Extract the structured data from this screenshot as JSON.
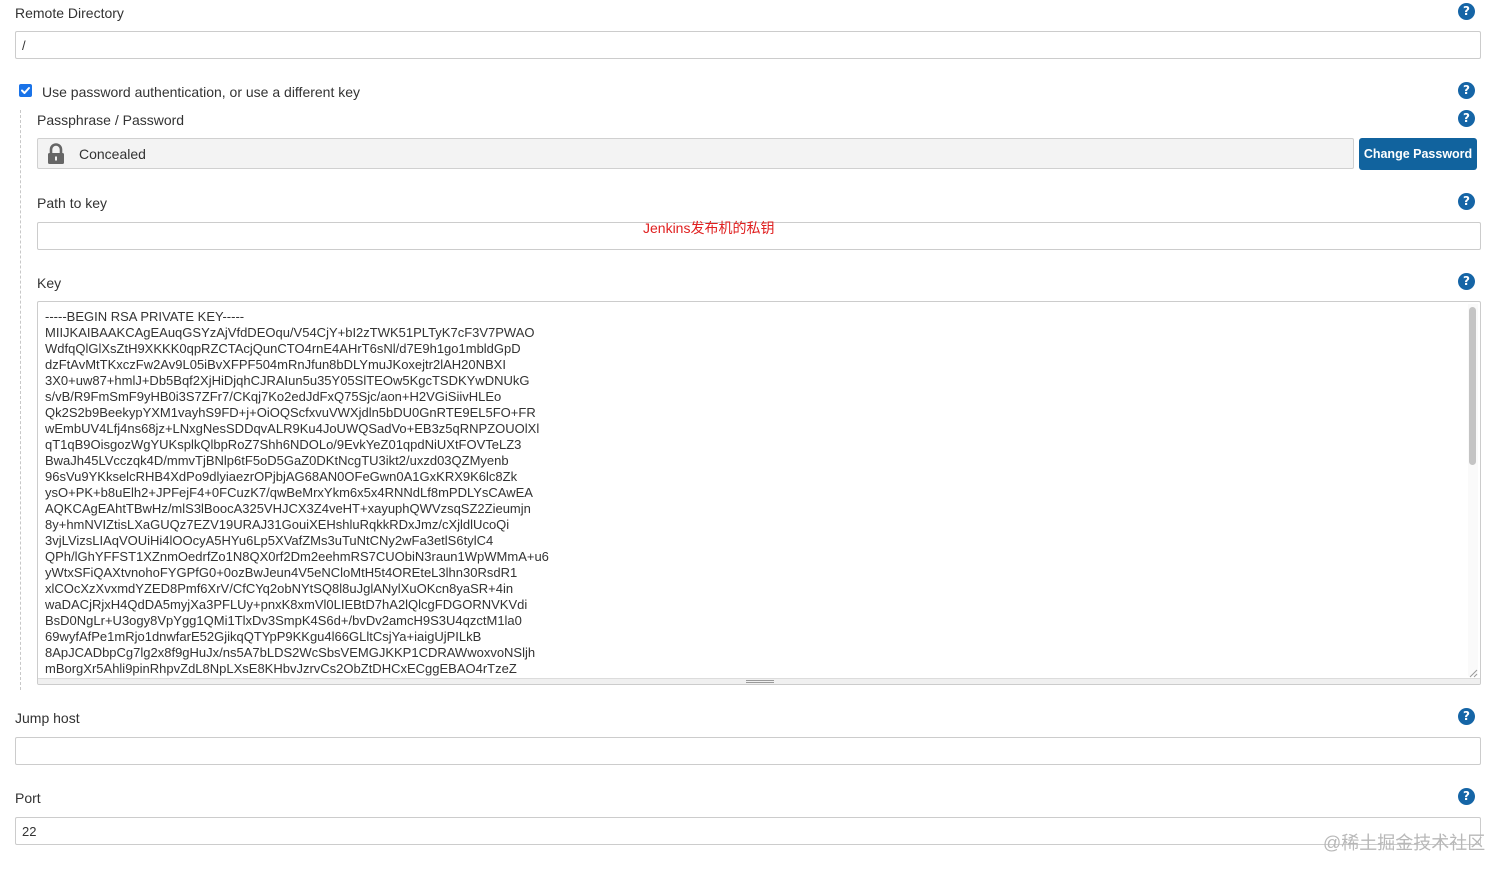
{
  "remote_directory": {
    "label": "Remote Directory",
    "value": "/"
  },
  "password_auth": {
    "checked": true,
    "label": "Use password authentication, or use a different key"
  },
  "passphrase": {
    "label": "Passphrase / Password",
    "concealed_text": "Concealed",
    "change_button": "Change Password"
  },
  "path_to_key": {
    "label": "Path to key",
    "value": "",
    "annotation": "Jenkins发布机的私钥"
  },
  "key": {
    "label": "Key",
    "lines": [
      "-----BEGIN RSA PRIVATE KEY-----",
      "MIIJKAIBAAKCAgEAuqGSYzAjVfdDEOqu/V54CjY+bI2zTWK51PLTyK7cF3V7PWAO",
      "WdfqQlGlXsZtH9XKKK0qpRZCTAcjQunCTO4rnE4AHrT6sNl/d7E9h1go1mbldGpD",
      "dzFtAvMtTKxczFw2Av9L05iBvXFPF504mRnJfun8bDLYmuJKoxejtr2lAH20NBXI",
      "3X0+uw87+hmlJ+Db5Bqf2XjHiDjqhCJRAIun5u35Y05SlTEOw5KgcTSDKYwDNUkG",
      "s/vB/R9FmSmF9yHB0i3S7ZFr7/CKqj7Ko2edJdFxQ75Sjc/aon+H2VGiSiivHLEo",
      "Qk2S2b9BeekypYXM1vayhS9FD+j+OiOQScfxvuVWXjdln5bDU0GnRTE9EL5FO+FR",
      "wEmbUV4Lfj4ns68jz+LNxgNesSDDqvALR9Ku4JoUWQSadVo+EB3z5qRNPZOUOlXl",
      "qT1qB9OisgozWgYUKsplkQlbpRoZ7Shh6NDOLo/9EvkYeZ01qpdNiUXtFOVTeLZ3",
      "BwaJh45LVcczqk4D/mmvTjBNlp6tF5oD5GaZ0DKtNcgTU3ikt2/uxzd03QZMyenb",
      "96sVu9YKkselcRHB4XdPo9dlyiaezrOPjbjAG68AN0OFeGwn0A1GxKRX9K6lc8Zk",
      "ysO+PK+b8uElh2+JPFejF4+0FCuzK7/qwBeMrxYkm6x5x4RNNdLf8mPDLYsCAwEA",
      "AQKCAgEAhtTBwHz/mlS3lBoocA325VHJCX3Z4veHT+xayuphQWVzsqSZ2Zieumjn",
      "8y+hmNVIZtisLXaGUQz7EZV19URAJ31GouiXEHshluRqkkRDxJmz/cXjldlUcoQi",
      "3vjLVizsLIAqVOUiHi4lOOcyA5HYu6Lp5XVafZMs3uTuNtCNy2wFa3etlS6tylC4",
      "QPh/lGhYFFST1XZnmOedrfZo1N8QX0rf2Dm2eehmRS7CUObiN3raun1WpWMmA+u6",
      "yWtxSFiQAXtvnohoFYGPfG0+0ozBwJeun4V5eNCloMtH5t4OREteL3lhn30RsdR1",
      "xlCOcXzXvxmdYZED8Pmf6XrV/CfCYq2obNYtSQ8l8uJglANylXuOKcn8yaSR+4in",
      "waDACjRjxH4QdDA5myjXa3PFLUy+pnxK8xmVl0LIEBtD7hA2lQlcgFDGORNVKVdi",
      "BsD0NgLr+U3ogy8VpYgg1QMi1TlxDv3SmpK4S6d+/bvDv2amcH9S3U4qzctM1la0",
      "69wyfAfPe1mRjo1dnwfarE52GjikqQTYpP9KKgu4l66GLltCsjYa+iaigUjPILkB",
      "8ApJCADbpCg7lg2x8f9gHuJx/ns5A7bLDS2WcSbsVEMGJKKP1CDRAWwoxvoNSljh",
      "mBorgXr5Ahli9pinRhpvZdL8NpLXsE8KHbvJzrvCs2ObZtDHCxECggEBAO4rTzeZ"
    ]
  },
  "jump_host": {
    "label": "Jump host",
    "value": ""
  },
  "port": {
    "label": "Port",
    "value": "22"
  },
  "watermark": "@稀土掘金技术社区",
  "colors": {
    "accent": "#11639e",
    "help_icon": "#1565a6",
    "annotation": "#e02020"
  }
}
